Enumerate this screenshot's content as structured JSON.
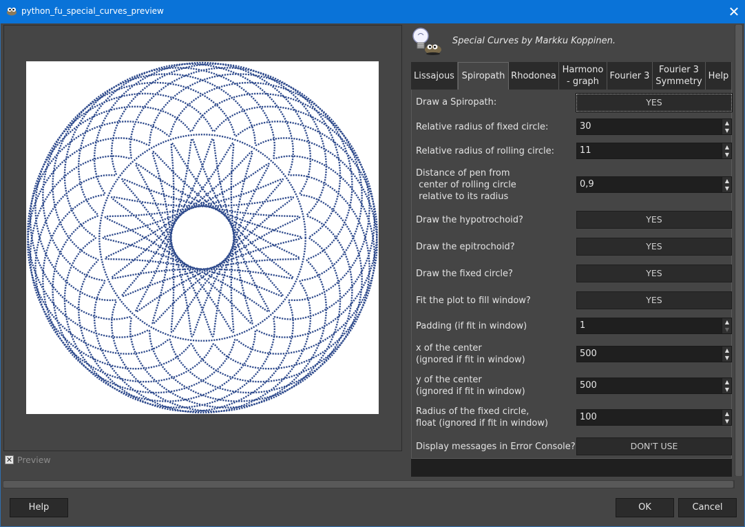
{
  "window": {
    "title": "python_fu_special_curves_preview",
    "close_glyph": "✕"
  },
  "header": {
    "text": "Special Curves by Markku Koppinen."
  },
  "tabs": [
    {
      "label": "Lissajous",
      "active": false
    },
    {
      "label": "Spiropath",
      "active": true
    },
    {
      "label": "Rhodonea",
      "active": false
    },
    {
      "label": "Harmono\n- graph",
      "active": false
    },
    {
      "label": "Fourier 3",
      "active": false
    },
    {
      "label": "Fourier 3\nSymmetry",
      "active": false
    },
    {
      "label": "Help",
      "active": false
    }
  ],
  "form": {
    "draw_spiropath": {
      "label": "Draw a Spiropath:",
      "value": "YES"
    },
    "fixed_radius": {
      "label": "Relative radius of fixed circle:",
      "value": "30"
    },
    "rolling_radius": {
      "label": "Relative radius of rolling circle:",
      "value": "11"
    },
    "pen_distance": {
      "label": "Distance of pen from\n center of rolling circle\n relative to its radius",
      "value": "0,9"
    },
    "hypotrochoid": {
      "label": "Draw the hypotrochoid?",
      "value": "YES"
    },
    "epitrochoid": {
      "label": "Draw the epitrochoid?",
      "value": "YES"
    },
    "fixed_circle": {
      "label": "Draw the fixed circle?",
      "value": "YES"
    },
    "fit_window": {
      "label": "Fit the plot to fill window?",
      "value": "YES"
    },
    "padding": {
      "label": "Padding (if fit in window)",
      "value": "1"
    },
    "x_center": {
      "label": "x of the center\n(ignored if fit in window)",
      "value": "500"
    },
    "y_center": {
      "label": "y of the center\n(ignored if fit in window)",
      "value": "500"
    },
    "radius_fixed": {
      "label": "Radius of the fixed circle,\nfloat (ignored if fit in window)",
      "value": "100"
    },
    "error_console": {
      "label": "Display messages in Error Console?",
      "value": "DON'T USE"
    }
  },
  "preview": {
    "label": "Preview",
    "checked": true,
    "curve_color": "#2e4a8c",
    "background_color": "#ffffff"
  },
  "footer": {
    "help_label": "Help",
    "ok_label": "OK",
    "cancel_label": "Cancel"
  },
  "colors": {
    "titlebar": "#0a73d8",
    "panel": "#454545",
    "field": "#1f1f1f",
    "button": "#2b2b2b"
  },
  "icons": {
    "app": "gimp-wilber-icon",
    "header": "lightbulb-wilber-icon",
    "spin_up": "▲",
    "spin_down": "▼",
    "check": "✕"
  }
}
